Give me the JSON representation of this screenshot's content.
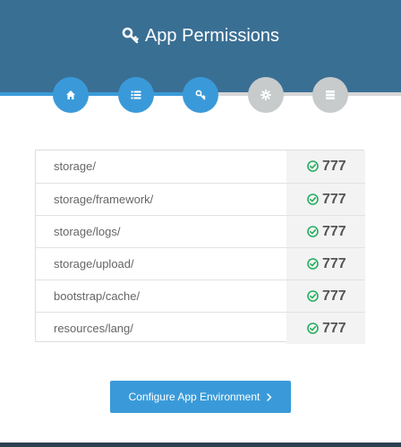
{
  "header": {
    "title": "App Permissions",
    "icon": "key-icon"
  },
  "steps": [
    {
      "icon": "home-icon",
      "state": "active"
    },
    {
      "icon": "list-icon",
      "state": "active"
    },
    {
      "icon": "key-icon",
      "state": "active"
    },
    {
      "icon": "gear-icon",
      "state": "inactive"
    },
    {
      "icon": "server-icon",
      "state": "inactive"
    }
  ],
  "permissions": [
    {
      "path": "storage/",
      "value": "777"
    },
    {
      "path": "storage/framework/",
      "value": "777"
    },
    {
      "path": "storage/logs/",
      "value": "777"
    },
    {
      "path": "storage/upload/",
      "value": "777"
    },
    {
      "path": "bootstrap/cache/",
      "value": "777"
    },
    {
      "path": "resources/lang/",
      "value": "777"
    }
  ],
  "button": {
    "label": "Configure App Environment"
  },
  "colors": {
    "header": "#3a6f94",
    "accent": "#3a9ad9",
    "success": "#27ae60",
    "inactive": "#c8cbcc",
    "footer": "#2c3e50"
  }
}
